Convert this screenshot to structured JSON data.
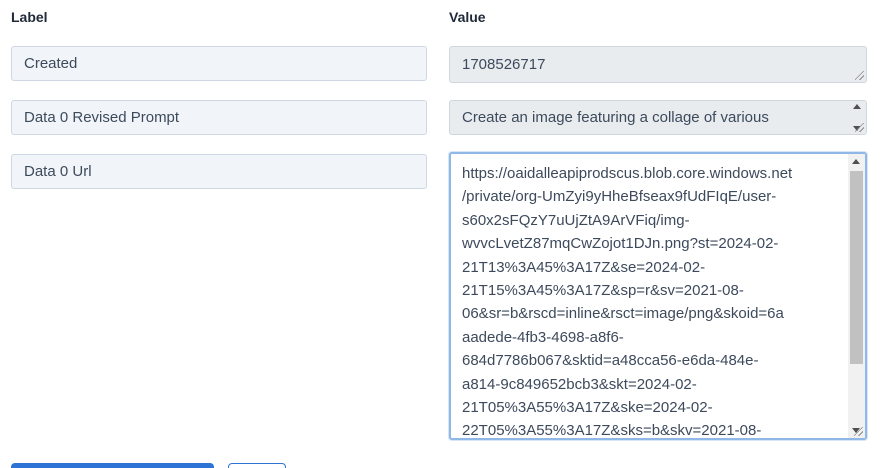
{
  "headers": {
    "label": "Label",
    "value": "Value"
  },
  "rows": [
    {
      "label": "Created",
      "value": "1708526717"
    },
    {
      "label": "Data 0 Revised Prompt",
      "value": "Create an image featuring a collage of various"
    },
    {
      "label": "Data 0 Url",
      "value": "https://oaidalleapiprodscus.blob.core.windows.net\n/private/org-UmZyi9yHheBfseax9fUdFIqE/user-\ns60x2sFQzY7uUjZtA9ArVFiq/img-\nwvvcLvetZ87mqCwZojot1DJn.png?st=2024-02-\n21T13%3A45%3A17Z&se=2024-02-\n21T15%3A45%3A17Z&sp=r&sv=2021-08-\n06&sr=b&rscd=inline&rsct=image/png&skoid=6a\naadede-4fb3-4698-a8f6-\n684d7786b067&sktid=a48cca56-e6da-484e-\na814-9c849652bcb3&skt=2024-02-\n21T05%3A55%3A17Z&ske=2024-02-\n22T05%3A55%3A17Z&sks=b&skv=2021-08-"
    }
  ],
  "colors": {
    "accent": "#2e74d6",
    "focus_border": "#8fb8e6",
    "readonly_bg": "#e9ecef",
    "label_bg": "#f1f5f9"
  }
}
